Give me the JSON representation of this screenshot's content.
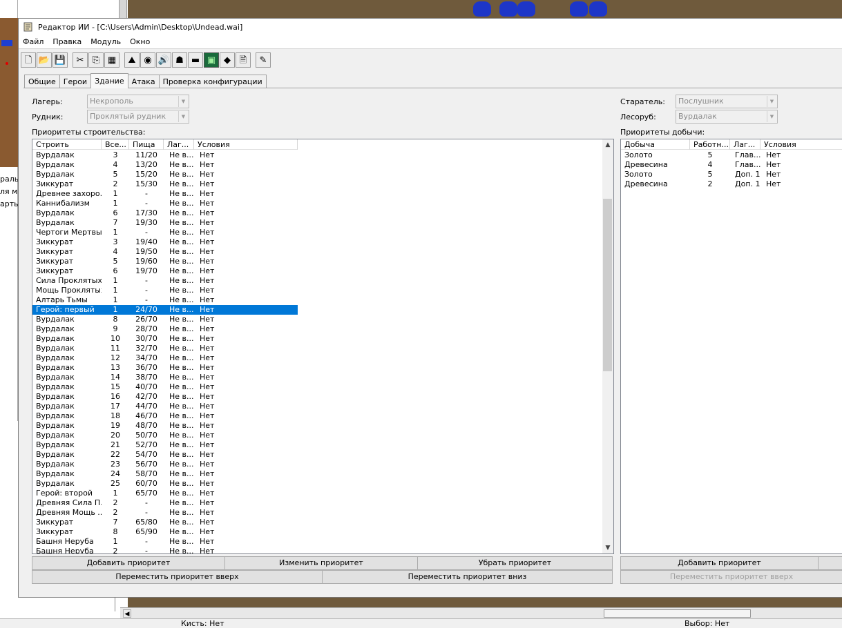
{
  "background": {
    "left_text": [
      "рально",
      "ля мо",
      "арты"
    ],
    "status": {
      "brush": "Кисть: Нет",
      "selection": "Выбор: Нет"
    }
  },
  "window": {
    "title": "Редактор ИИ - [C:\\Users\\Admin\\Desktop\\Undead.wai]",
    "menu": [
      "Файл",
      "Правка",
      "Модуль",
      "Окно"
    ]
  },
  "toolbar": {
    "buttons": [
      "new-file-icon",
      "open-folder-icon",
      "save-icon",
      "cut-icon",
      "copy-icon",
      "paste-icon",
      "race-icon",
      "gold-icon",
      "sound-icon",
      "hero-icon",
      "unit-icon",
      "building-icon",
      "tower-icon",
      "new-doc-icon",
      "edit-icon"
    ]
  },
  "tabs": [
    "Общие",
    "Герои",
    "Здание",
    "Атака",
    "Проверка конфигурации"
  ],
  "active_tab": "Здание",
  "fields": {
    "camp_label": "Лагерь:",
    "camp_value": "Некрополь",
    "mine_label": "Рудник:",
    "mine_value": "Проклятый рудник",
    "worker_label": "Старатель:",
    "worker_value": "Послушник",
    "lumber_label": "Лесоруб:",
    "lumber_value": "Вурдалак"
  },
  "build_section": {
    "label": "Приоритеты строительства:",
    "columns": [
      "Строить",
      "Все...",
      "Пища",
      "Лаг...",
      "Условия"
    ],
    "selected_index": 16,
    "rows": [
      [
        "Вурдалак",
        "3",
        "11/20",
        "Не в...",
        "Нет"
      ],
      [
        "Вурдалак",
        "4",
        "13/20",
        "Не в...",
        "Нет"
      ],
      [
        "Вурдалак",
        "5",
        "15/20",
        "Не в...",
        "Нет"
      ],
      [
        "Зиккурат",
        "2",
        "15/30",
        "Не в...",
        "Нет"
      ],
      [
        "Древнее захоро...",
        "1",
        "-",
        "Не в...",
        "Нет"
      ],
      [
        "Каннибализм",
        "1",
        "-",
        "Не в...",
        "Нет"
      ],
      [
        "Вурдалак",
        "6",
        "17/30",
        "Не в...",
        "Нет"
      ],
      [
        "Вурдалак",
        "7",
        "19/30",
        "Не в...",
        "Нет"
      ],
      [
        "Чертоги Мертвых",
        "1",
        "-",
        "Не в...",
        "Нет"
      ],
      [
        "Зиккурат",
        "3",
        "19/40",
        "Не в...",
        "Нет"
      ],
      [
        "Зиккурат",
        "4",
        "19/50",
        "Не в...",
        "Нет"
      ],
      [
        "Зиккурат",
        "5",
        "19/60",
        "Не в...",
        "Нет"
      ],
      [
        "Зиккурат",
        "6",
        "19/70",
        "Не в...",
        "Нет"
      ],
      [
        "Сила Проклятых",
        "1",
        "-",
        "Не в...",
        "Нет"
      ],
      [
        "Мощь Проклятых",
        "1",
        "-",
        "Не в...",
        "Нет"
      ],
      [
        "Алтарь Тьмы",
        "1",
        "-",
        "Не в...",
        "Нет"
      ],
      [
        "Герой: первый",
        "1",
        "24/70",
        "Не в...",
        "Нет"
      ],
      [
        "Вурдалак",
        "8",
        "26/70",
        "Не в...",
        "Нет"
      ],
      [
        "Вурдалак",
        "9",
        "28/70",
        "Не в...",
        "Нет"
      ],
      [
        "Вурдалак",
        "10",
        "30/70",
        "Не в...",
        "Нет"
      ],
      [
        "Вурдалак",
        "11",
        "32/70",
        "Не в...",
        "Нет"
      ],
      [
        "Вурдалак",
        "12",
        "34/70",
        "Не в...",
        "Нет"
      ],
      [
        "Вурдалак",
        "13",
        "36/70",
        "Не в...",
        "Нет"
      ],
      [
        "Вурдалак",
        "14",
        "38/70",
        "Не в...",
        "Нет"
      ],
      [
        "Вурдалак",
        "15",
        "40/70",
        "Не в...",
        "Нет"
      ],
      [
        "Вурдалак",
        "16",
        "42/70",
        "Не в...",
        "Нет"
      ],
      [
        "Вурдалак",
        "17",
        "44/70",
        "Не в...",
        "Нет"
      ],
      [
        "Вурдалак",
        "18",
        "46/70",
        "Не в...",
        "Нет"
      ],
      [
        "Вурдалак",
        "19",
        "48/70",
        "Не в...",
        "Нет"
      ],
      [
        "Вурдалак",
        "20",
        "50/70",
        "Не в...",
        "Нет"
      ],
      [
        "Вурдалак",
        "21",
        "52/70",
        "Не в...",
        "Нет"
      ],
      [
        "Вурдалак",
        "22",
        "54/70",
        "Не в...",
        "Нет"
      ],
      [
        "Вурдалак",
        "23",
        "56/70",
        "Не в...",
        "Нет"
      ],
      [
        "Вурдалак",
        "24",
        "58/70",
        "Не в...",
        "Нет"
      ],
      [
        "Вурдалак",
        "25",
        "60/70",
        "Не в...",
        "Нет"
      ],
      [
        "Герой: второй",
        "1",
        "65/70",
        "Не в...",
        "Нет"
      ],
      [
        "Древняя Сила П...",
        "2",
        "-",
        "Не в...",
        "Нет"
      ],
      [
        "Древняя Мощь ...",
        "2",
        "-",
        "Не в...",
        "Нет"
      ],
      [
        "Зиккурат",
        "7",
        "65/80",
        "Не в...",
        "Нет"
      ],
      [
        "Зиккурат",
        "8",
        "65/90",
        "Не в...",
        "Нет"
      ],
      [
        "Башня Неруба",
        "1",
        "-",
        "Не в...",
        "Нет"
      ],
      [
        "Башня Неруба",
        "2",
        "-",
        "Не в...",
        "Нет"
      ]
    ],
    "buttons": {
      "add": "Добавить приоритет",
      "edit": "Изменить приоритет",
      "remove": "Убрать приоритет",
      "move_up": "Переместить приоритет вверх",
      "move_down": "Переместить приоритет вниз"
    }
  },
  "harvest_section": {
    "label": "Приоритеты добычи:",
    "columns": [
      "Добыча",
      "Работн...",
      "Лаг...",
      "Условия"
    ],
    "rows": [
      [
        "Золото",
        "5",
        "Глав...",
        "Нет"
      ],
      [
        "Древесина",
        "4",
        "Глав...",
        "Нет"
      ],
      [
        "Золото",
        "5",
        "Доп. 1",
        "Нет"
      ],
      [
        "Древесина",
        "2",
        "Доп. 1",
        "Нет"
      ]
    ],
    "buttons": {
      "add": "Добавить приоритет",
      "move_up": "Переместить приоритет вверх"
    }
  }
}
